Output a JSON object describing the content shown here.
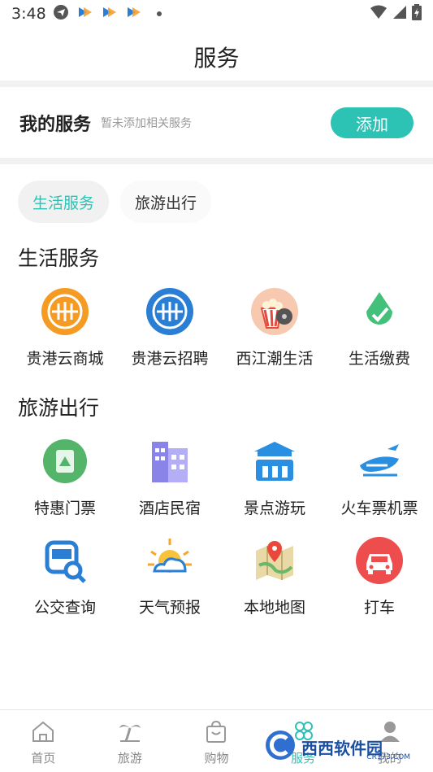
{
  "status_bar": {
    "time": "3:48"
  },
  "header": {
    "title": "服务"
  },
  "my_services": {
    "title": "我的服务",
    "hint": "暂未添加相关服务",
    "add_label": "添加"
  },
  "tabs": [
    {
      "label": "生活服务",
      "active": true
    },
    {
      "label": "旅游出行",
      "active": false
    }
  ],
  "life_section": {
    "title": "生活服务",
    "items": [
      {
        "label": "贵港云商城",
        "icon": "gui-gang-yun-mall-icon"
      },
      {
        "label": "贵港云招聘",
        "icon": "gui-gang-yun-recruit-icon"
      },
      {
        "label": "西江潮生活",
        "icon": "popcorn-film-icon"
      },
      {
        "label": "生活缴费",
        "icon": "payment-drop-check-icon"
      }
    ]
  },
  "travel_section": {
    "title": "旅游出行",
    "items": [
      {
        "label": "特惠门票",
        "icon": "ticket-icon"
      },
      {
        "label": "酒店民宿",
        "icon": "hotel-icon"
      },
      {
        "label": "景点游玩",
        "icon": "scenic-gate-icon"
      },
      {
        "label": "火车票机票",
        "icon": "train-plane-icon"
      },
      {
        "label": "公交查询",
        "icon": "bus-search-icon"
      },
      {
        "label": "天气预报",
        "icon": "weather-icon"
      },
      {
        "label": "本地地图",
        "icon": "map-pin-icon"
      },
      {
        "label": "打车",
        "icon": "taxi-icon"
      }
    ]
  },
  "bottom_nav": [
    {
      "label": "首页",
      "icon": "home-icon"
    },
    {
      "label": "旅游",
      "icon": "palm-tree-icon"
    },
    {
      "label": "购物",
      "icon": "shopping-bag-icon"
    },
    {
      "label": "服务",
      "icon": "service-icon"
    },
    {
      "label": "我的",
      "icon": "profile-icon"
    }
  ],
  "watermark": {
    "brand": "西西软件园",
    "url": "CR173.COM"
  },
  "colors": {
    "accent": "#2cc3b5",
    "orange": "#f59a23",
    "blue": "#2a7fd4",
    "red": "#ee4d4d",
    "green": "#43c07a"
  }
}
